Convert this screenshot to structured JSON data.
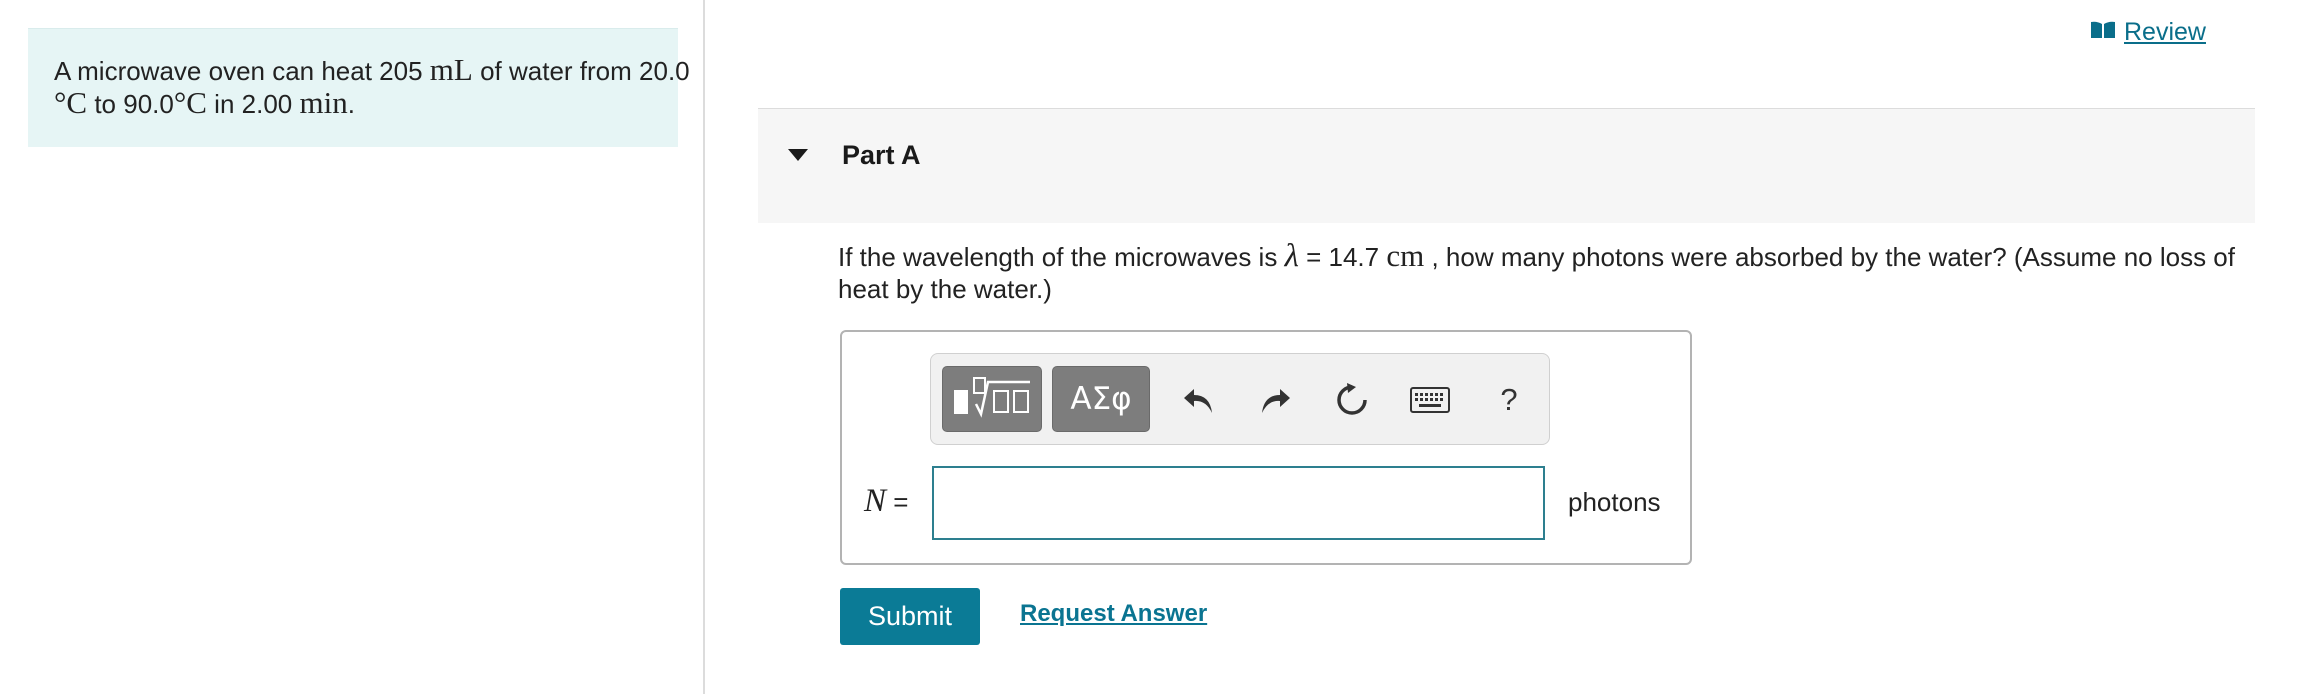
{
  "problem": {
    "intro_1": "A microwave oven can heat 205",
    "intro_unit_mL": "mL",
    "intro_2": "of water from 20.0",
    "intro_deg1": "°",
    "intro_C1": "C",
    "intro_3": "to 90.0",
    "intro_deg2": "°",
    "intro_C2": "C",
    "intro_4": "in 2.00",
    "intro_min": "min",
    "intro_5": "."
  },
  "review": {
    "label": "Review",
    "icon": "book-icon"
  },
  "part": {
    "title": "Part A",
    "caret_icon": "caret-down-icon"
  },
  "question": {
    "text_1": "If the wavelength of the microwaves is",
    "lambda": "λ",
    "text_2": "= 14.7",
    "unit_cm": "cm",
    "text_3": ", how many photons were absorbed by the water? (Assume no loss of heat by the water.)"
  },
  "toolbar": {
    "templates_icon": "templates-icon",
    "greek_label": "ΑΣφ",
    "undo_icon": "undo-icon",
    "redo_icon": "redo-icon",
    "reset_icon": "reset-icon",
    "keyboard_icon": "keyboard-icon",
    "help_label": "?"
  },
  "answer": {
    "variable": "N",
    "equals": "=",
    "value": "",
    "unit": "photons"
  },
  "actions": {
    "submit_label": "Submit",
    "request_label": "Request Answer"
  },
  "colors": {
    "accent": "#0b7b96",
    "intro_bg": "#e6f5f5",
    "header_bg": "#f6f6f6",
    "toolbar_dark": "#7d7d7d"
  }
}
